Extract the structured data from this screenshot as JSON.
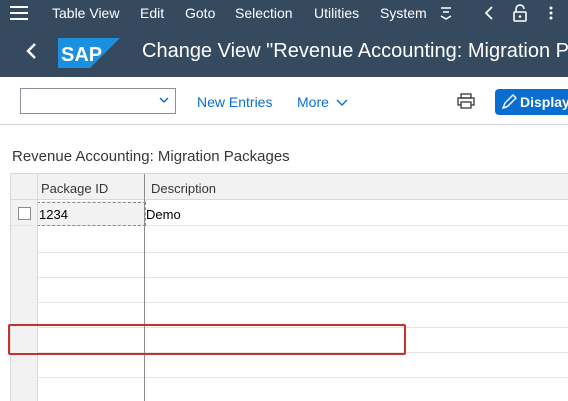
{
  "menubar": {
    "items": [
      "Table View",
      "Edit",
      "Goto",
      "Selection",
      "Utilities",
      "System"
    ],
    "icons": [
      "menu-icon",
      "more-menu-icon",
      "back-arrow-icon",
      "lock-icon"
    ]
  },
  "titlebar": {
    "logo": "SAP",
    "title": "Change View \"Revenue Accounting: Migration P"
  },
  "toolbar": {
    "command_value": "",
    "new_entries": "New Entries",
    "more": "More",
    "display": "Display"
  },
  "main": {
    "section_title": "Revenue Accounting: Migration Packages",
    "table": {
      "columns": [
        "Package ID",
        "Description"
      ],
      "rows": [
        {
          "package_id": "1234",
          "description": "Demo"
        }
      ]
    }
  },
  "colors": {
    "shell": "#354a5f",
    "accent": "#0a6ed1",
    "highlight": "#c8302c"
  }
}
